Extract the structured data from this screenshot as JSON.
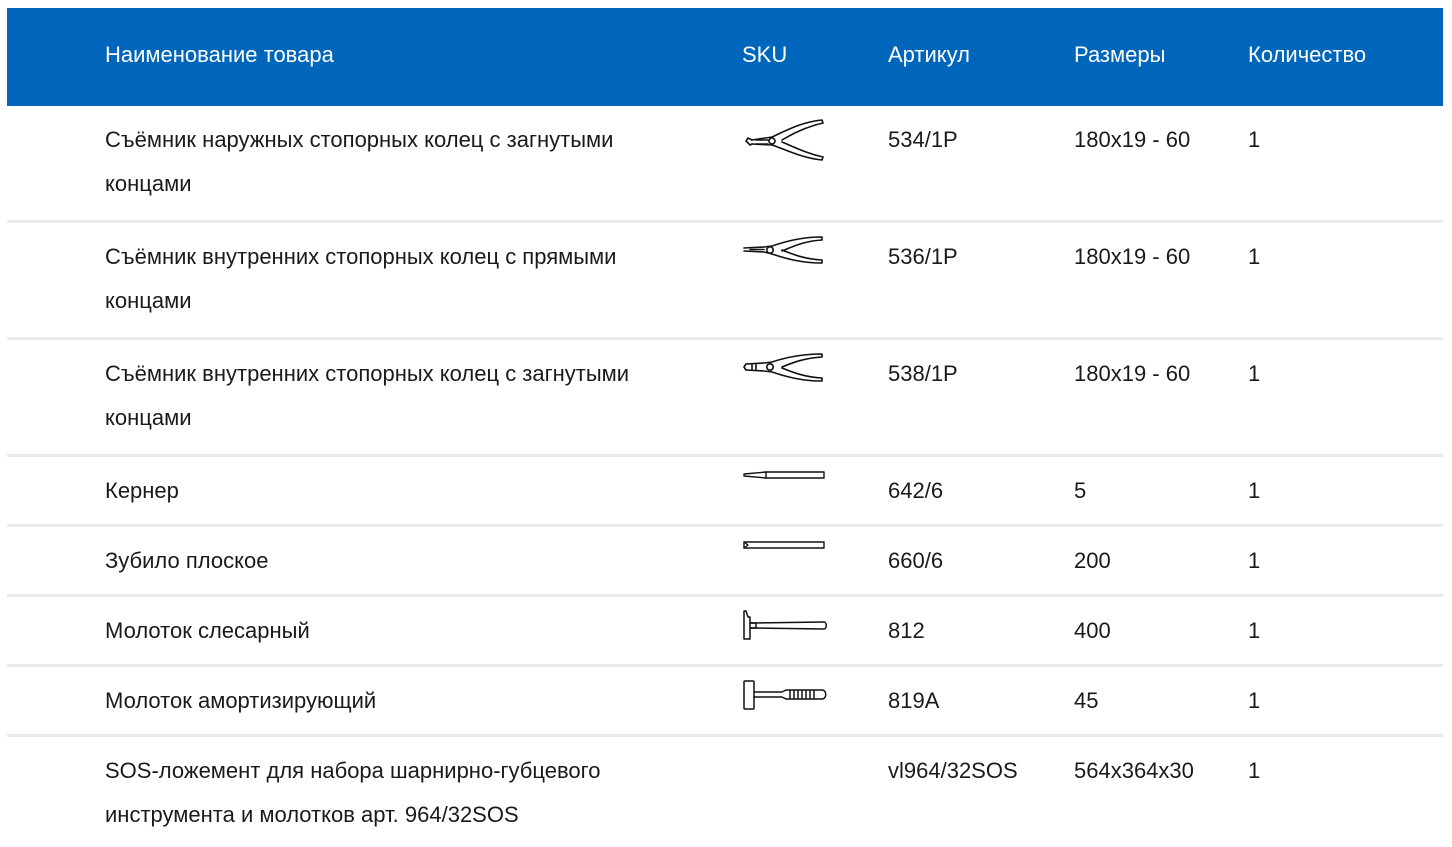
{
  "header": {
    "name": "Наименование товара",
    "sku": "SKU",
    "article": "Артикул",
    "size": "Размеры",
    "qty": "Количество"
  },
  "colors": {
    "header_bg": "#0066bb",
    "header_text": "#ffffff",
    "divider": "#e9e9e9"
  },
  "rows": [
    {
      "name": "Съёмник наружных стопорных колец с загнутыми концами",
      "icon": "bent-external-circlip-pliers-icon",
      "article": "534/1P",
      "size": "180x19 - 60",
      "qty": "1"
    },
    {
      "name": "Съёмник внутренних стопорных колец с прямыми концами",
      "icon": "straight-internal-circlip-pliers-icon",
      "article": "536/1P",
      "size": "180x19 - 60",
      "qty": "1"
    },
    {
      "name": "Съёмник внутренних стопорных колец с загнутыми концами",
      "icon": "bent-internal-circlip-pliers-icon",
      "article": "538/1P",
      "size": "180x19 - 60",
      "qty": "1"
    },
    {
      "name": "Кернер",
      "icon": "center-punch-icon",
      "article": "642/6",
      "size": "5",
      "qty": "1"
    },
    {
      "name": "Зубило плоское",
      "icon": "flat-chisel-icon",
      "article": "660/6",
      "size": "200",
      "qty": "1"
    },
    {
      "name": "Молоток слесарный",
      "icon": "machinist-hammer-icon",
      "article": "812",
      "size": "400",
      "qty": "1"
    },
    {
      "name": "Молоток амортизирующий",
      "icon": "dead-blow-hammer-icon",
      "article": "819A",
      "size": "45",
      "qty": "1"
    },
    {
      "name": "SOS-ложемент для набора шарнирно-губцевого инструмента и молотков арт. 964/32SOS",
      "icon": "",
      "article": "vl964/32SOS",
      "size": "564x364x30",
      "qty": "1"
    }
  ]
}
